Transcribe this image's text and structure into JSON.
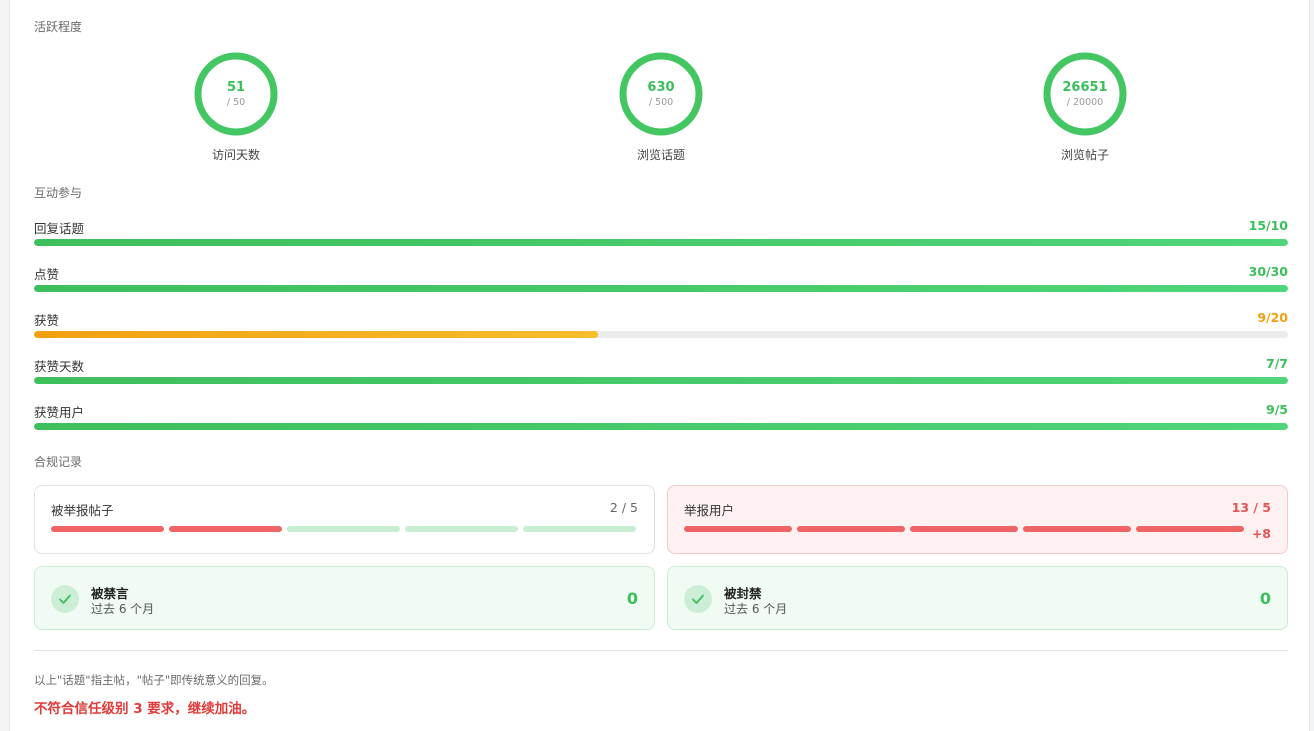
{
  "activity": {
    "title": "活跃程度",
    "rings": [
      {
        "value": "51",
        "target": "/ 50",
        "label": "访问天数"
      },
      {
        "value": "630",
        "target": "/ 500",
        "label": "浏览话题"
      },
      {
        "value": "26651",
        "target": "/ 20000",
        "label": "浏览帖子"
      }
    ]
  },
  "interaction": {
    "title": "互动参与",
    "rows": [
      {
        "label": "回复话题",
        "value": "15/10",
        "progress": 1.0,
        "status": "ok"
      },
      {
        "label": "点赞",
        "value": "30/30",
        "progress": 1.0,
        "status": "ok"
      },
      {
        "label": "获赞",
        "value": "9/20",
        "progress": 0.45,
        "status": "warn"
      },
      {
        "label": "获赞天数",
        "value": "7/7",
        "progress": 1.0,
        "status": "ok"
      },
      {
        "label": "获赞用户",
        "value": "9/5",
        "progress": 1.0,
        "status": "ok"
      }
    ]
  },
  "compliance": {
    "title": "合规记录",
    "reported_posts": {
      "label": "被举报帖子",
      "count": "2 / 5",
      "filled": 2,
      "total": 5
    },
    "reported_users": {
      "label": "举报用户",
      "count": "13 / 5",
      "filled": 5,
      "total": 5,
      "extra": "+8"
    },
    "silenced": {
      "label": "被禁言",
      "period": "过去 6 个月",
      "value": "0"
    },
    "suspended": {
      "label": "被封禁",
      "period": "过去 6 个月",
      "value": "0"
    }
  },
  "footer": {
    "note": "以上\"话题\"指主帖，\"帖子\"即传统意义的回复。",
    "warning": "不符合信任级别 3 要求，继续加油。"
  },
  "colors": {
    "green": "#3bbf5a",
    "green_light": "#c9efd3",
    "orange": "#f2a012",
    "red": "#ef6464",
    "red_bg": "#fff1f1"
  },
  "icons": {
    "check": "check-icon"
  }
}
